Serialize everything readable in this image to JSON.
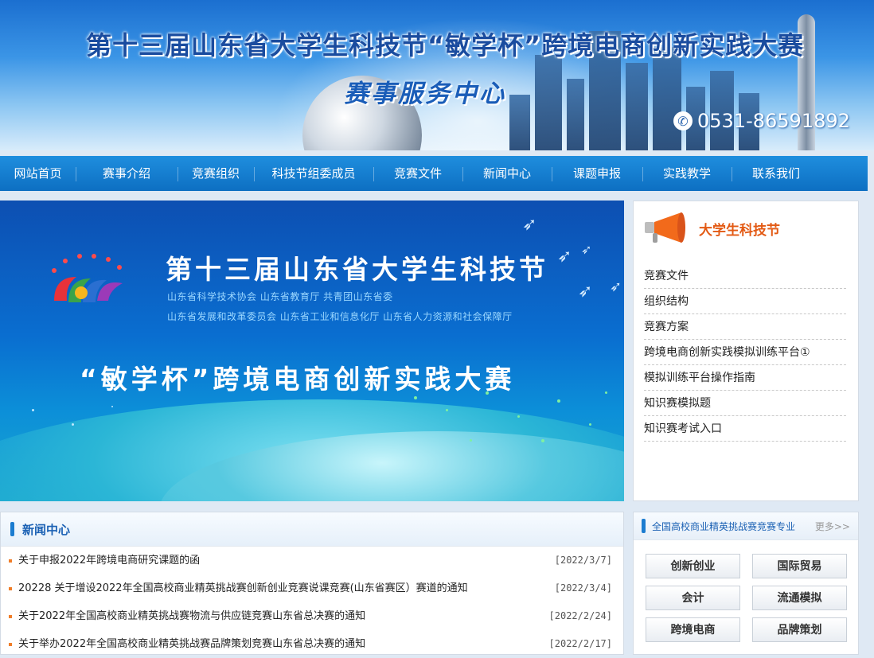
{
  "banner": {
    "title": "第十三届山东省大学生科技节“敏学杯”跨境电商创新实践大赛",
    "subtitle": "赛事服务中心",
    "phone": "0531-86591892",
    "phone_icon": "phone-icon"
  },
  "nav": {
    "items": [
      {
        "label": "网站首页"
      },
      {
        "label": "赛事介绍"
      },
      {
        "label": "竞赛组织"
      },
      {
        "label": "科技节组委成员"
      },
      {
        "label": "竞赛文件"
      },
      {
        "label": "新闻中心"
      },
      {
        "label": "课题申报"
      },
      {
        "label": "实践教学"
      },
      {
        "label": "联系我们"
      }
    ]
  },
  "hero": {
    "title": "第十三届山东省大学生科技节",
    "orgs_line1": "山东省科学技术协会   山东省教育厅   共青团山东省委",
    "orgs_line2": "山东省发展和改革委员会   山东省工业和信息化厅   山东省人力资源和社会保障厅",
    "contest": "“敏学杯”跨境电商创新实践大赛"
  },
  "sidebar": {
    "title": "大学生科技节",
    "links": [
      {
        "label": "竞赛文件"
      },
      {
        "label": "组织结构"
      },
      {
        "label": "竞赛方案"
      },
      {
        "label": "跨境电商创新实践模拟训练平台①"
      },
      {
        "label": "模拟训练平台操作指南"
      },
      {
        "label": "知识赛模拟题"
      },
      {
        "label": "知识赛考试入口"
      }
    ]
  },
  "news": {
    "title": "新闻中心",
    "items": [
      {
        "title": "关于申报2022年跨境电商研究课题的函",
        "date": "[2022/3/7]"
      },
      {
        "title": "20228 关于增设2022年全国高校商业精英挑战赛创新创业竞赛说课竞赛(山东省赛区）赛道的通知",
        "date": "[2022/3/4]"
      },
      {
        "title": "关于2022年全国高校商业精英挑战赛物流与供应链竞赛山东省总决赛的通知",
        "date": "[2022/2/24]"
      },
      {
        "title": "关于举办2022年全国高校商业精英挑战赛品牌策划竞赛山东省总决赛的通知",
        "date": "[2022/2/17]"
      }
    ]
  },
  "majors": {
    "title": "全国高校商业精英挑战赛竞赛专业",
    "more": "更多>>",
    "buttons": [
      {
        "label": "创新创业"
      },
      {
        "label": "国际贸易"
      },
      {
        "label": "会计"
      },
      {
        "label": "流通模拟"
      },
      {
        "label": "跨境电商"
      },
      {
        "label": "品牌策划"
      }
    ]
  },
  "colors": {
    "nav_bg": "#0d6fc2",
    "accent_orange": "#e35a14",
    "link_blue": "#1b61b4"
  }
}
